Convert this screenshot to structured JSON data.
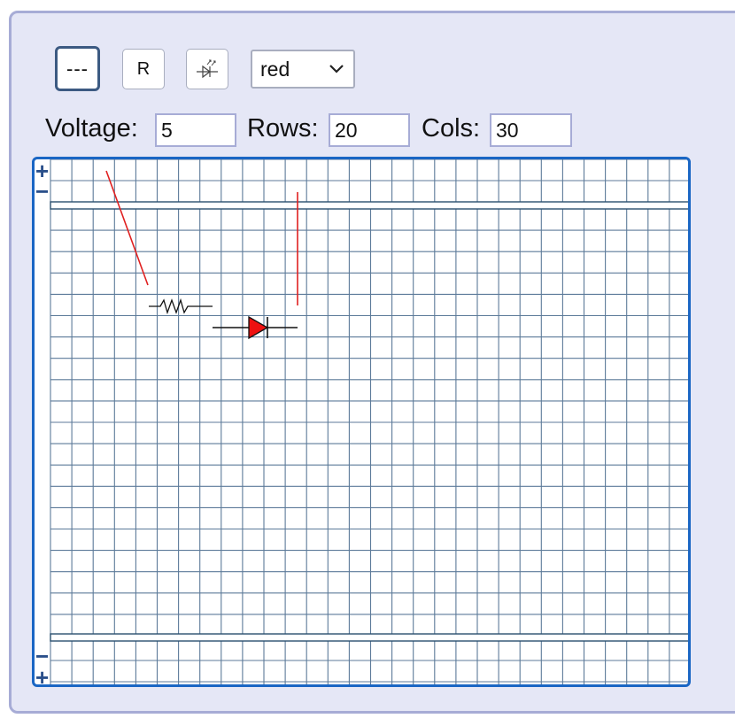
{
  "toolbar": {
    "wire_label": "---",
    "resistor_label": "R",
    "led_icon": "led-icon",
    "color_select": {
      "value": "red",
      "icon": "chevron-down-icon"
    }
  },
  "settings": {
    "voltage_label": "Voltage:",
    "voltage_value": "5",
    "rows_label": "Rows:",
    "rows_value": "20",
    "cols_label": "Cols:",
    "cols_value": "30"
  },
  "breadboard": {
    "rails": {
      "top": [
        "+",
        "−"
      ],
      "bottom": [
        "−",
        "+"
      ]
    },
    "colors": {
      "grid": "#5c7a99",
      "border": "#1a66c4",
      "wire": "#e02020",
      "led": "#ee1111"
    }
  }
}
